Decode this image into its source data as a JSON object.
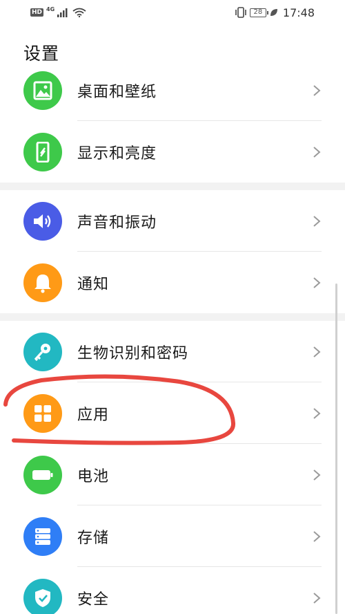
{
  "status_bar": {
    "hd": "HD",
    "network": "4G",
    "battery": "28",
    "time": "17:48"
  },
  "header": {
    "title": "设置"
  },
  "settings": {
    "items": [
      {
        "label": "桌面和壁纸",
        "icon": "image-icon",
        "color": "#3ec94a"
      },
      {
        "label": "显示和亮度",
        "icon": "phone-brightness-icon",
        "color": "#3ec94a"
      },
      {
        "label": "声音和振动",
        "icon": "speaker-icon",
        "color": "#4a5ce6"
      },
      {
        "label": "通知",
        "icon": "bell-icon",
        "color": "#ff9a16"
      },
      {
        "label": "生物识别和密码",
        "icon": "key-icon",
        "color": "#22b8c2"
      },
      {
        "label": "应用",
        "icon": "grid-icon",
        "color": "#ff9a16"
      },
      {
        "label": "电池",
        "icon": "battery-icon",
        "color": "#3ec94a"
      },
      {
        "label": "存储",
        "icon": "storage-icon",
        "color": "#2f7ef6"
      },
      {
        "label": "安全",
        "icon": "shield-icon",
        "color": "#22b8c2"
      }
    ]
  },
  "annotation": {
    "color": "#e8473f",
    "target": "应用"
  }
}
